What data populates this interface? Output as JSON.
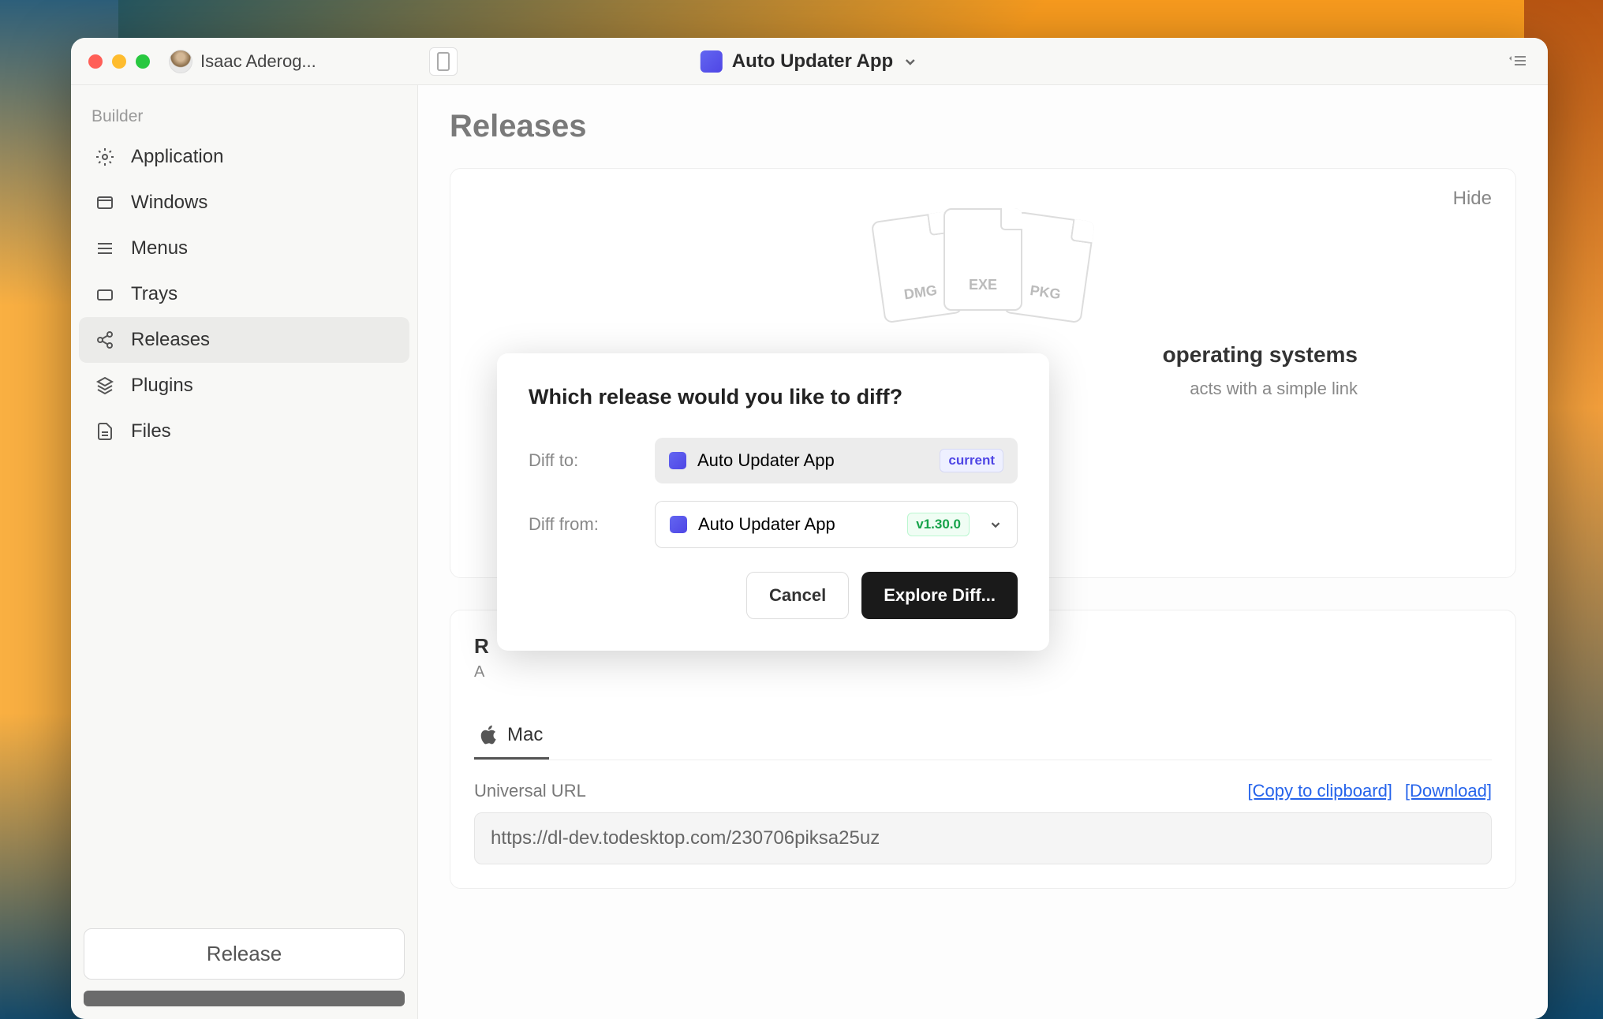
{
  "titlebar": {
    "user_name": "Isaac Aderog...",
    "app_name": "Auto Updater App"
  },
  "sidebar": {
    "section_label": "Builder",
    "items": [
      {
        "label": "Application",
        "icon": "gear"
      },
      {
        "label": "Windows",
        "icon": "window"
      },
      {
        "label": "Menus",
        "icon": "menu"
      },
      {
        "label": "Trays",
        "icon": "tray"
      },
      {
        "label": "Releases",
        "icon": "share",
        "active": true
      },
      {
        "label": "Plugins",
        "icon": "layers"
      },
      {
        "label": "Files",
        "icon": "document"
      }
    ],
    "release_button": "Release"
  },
  "main": {
    "page_title": "Releases",
    "hero": {
      "hide_label": "Hide",
      "file_types": [
        "DMG",
        "EXE",
        "PKG"
      ],
      "heading_suffix": "operating systems",
      "sub_suffix": "acts with a simple link"
    },
    "section": {
      "heading_prefix": "R",
      "sub_prefix": "A"
    },
    "tab": {
      "label": "Mac"
    },
    "url": {
      "label": "Universal URL",
      "copy_label": "[Copy to clipboard]",
      "download_label": "[Download]",
      "value": "https://dl-dev.todesktop.com/230706piksa25uz"
    }
  },
  "modal": {
    "title": "Which release would you like to diff?",
    "diff_to_label": "Diff to:",
    "diff_from_label": "Diff from:",
    "diff_to_app": "Auto Updater App",
    "diff_to_badge": "current",
    "diff_from_app": "Auto Updater App",
    "diff_from_badge": "v1.30.0",
    "cancel_label": "Cancel",
    "explore_label": "Explore Diff..."
  }
}
